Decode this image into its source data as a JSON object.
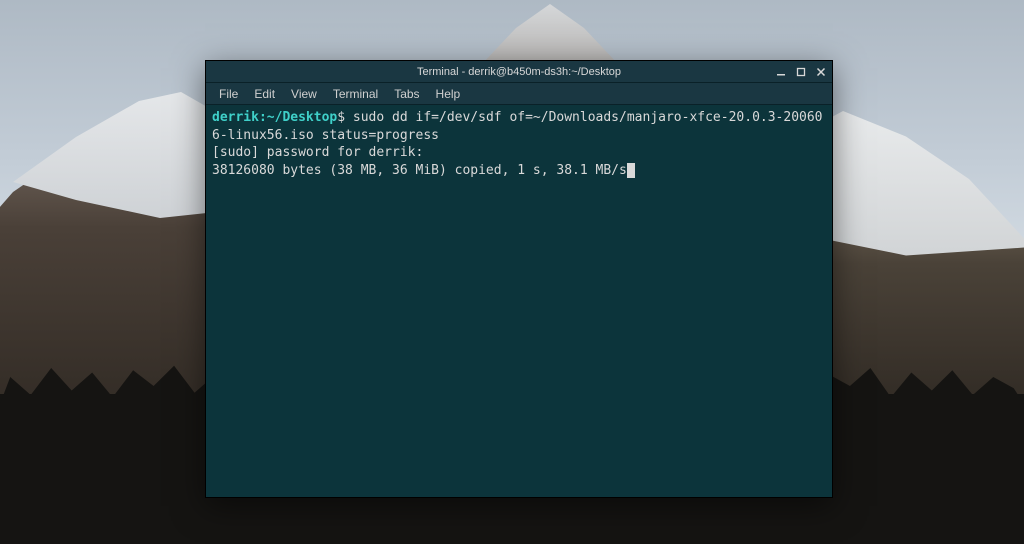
{
  "window": {
    "title": "Terminal - derrik@b450m-ds3h:~/Desktop"
  },
  "menubar": {
    "items": [
      "File",
      "Edit",
      "View",
      "Terminal",
      "Tabs",
      "Help"
    ]
  },
  "terminal": {
    "prompt_user": "derrik",
    "prompt_sep": ":",
    "prompt_path": "~/Desktop",
    "prompt_symbol": "$",
    "command": "sudo dd if=/dev/sdf of=~/Downloads/manjaro-xfce-20.0.3-200606-linux56.iso status=progress",
    "line2": "[sudo] password for derrik:",
    "line3": "38126080 bytes (38 MB, 36 MiB) copied, 1 s, 38.1 MB/s"
  }
}
